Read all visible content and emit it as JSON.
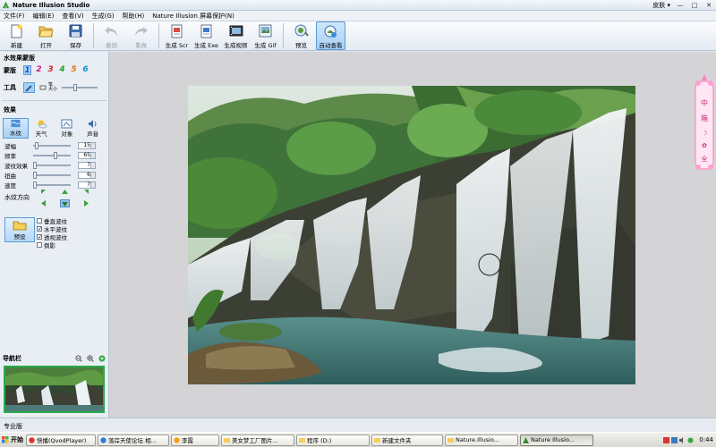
{
  "window": {
    "title": "Nature Illusion Studio",
    "skin_label": "皮肤 ▾",
    "minimize": "—",
    "maximize": "□",
    "close": "✕"
  },
  "menu": [
    "文件(F)",
    "编辑(E)",
    "查看(V)",
    "生成(G)",
    "帮助(H)",
    "Nature Illusion 屏幕保护(N)"
  ],
  "toolbar": {
    "buttons": [
      {
        "label": "新建",
        "icon": "new-file-icon"
      },
      {
        "label": "打开",
        "icon": "open-folder-icon"
      },
      {
        "label": "保存",
        "icon": "save-disk-icon"
      },
      {
        "label": "撤销",
        "icon": "undo-icon"
      },
      {
        "label": "重做",
        "icon": "redo-icon"
      },
      {
        "label": "生成 Scr",
        "icon": "generate-scr-icon"
      },
      {
        "label": "生成 Exe",
        "icon": "generate-exe-icon"
      },
      {
        "label": "生成视频",
        "icon": "generate-video-icon"
      },
      {
        "label": "生成 Gif",
        "icon": "generate-gif-icon"
      },
      {
        "label": "预览",
        "icon": "preview-icon"
      },
      {
        "label": "自动查看",
        "icon": "auto-view-icon"
      }
    ]
  },
  "left": {
    "water_title": "水效果蒙版",
    "mask_label": "蒙版",
    "numbers": [
      "1",
      "2",
      "3",
      "4",
      "5",
      "6"
    ],
    "number_colors": [
      "#1e4fd8",
      "#d01c8b",
      "#e02020",
      "#2a9a2a",
      "#e07a10",
      "#1a8fd6"
    ],
    "tools_label": "工具",
    "size_label": "笔\n大小",
    "effects_title": "效果",
    "tabs": [
      "水纹",
      "天气",
      "对象",
      "声音"
    ],
    "params": [
      {
        "name": "波幅",
        "value": "15",
        "level": 0.06
      },
      {
        "name": "频率",
        "value": "65",
        "level": 0.55
      },
      {
        "name": "波纹效果",
        "value": "7",
        "level": 0.02
      },
      {
        "name": "扭曲",
        "value": "6",
        "level": 0.02
      },
      {
        "name": "速度",
        "value": "7",
        "level": 0.02
      }
    ],
    "direction_label": "水纹方向",
    "preset_label": "预设",
    "checks": [
      {
        "label": "垂直波纹",
        "checked": false
      },
      {
        "label": "水平波纹",
        "checked": true
      },
      {
        "label": "透视波纹",
        "checked": true
      },
      {
        "label": "倒影",
        "checked": false
      }
    ],
    "nav_title": "导航栏"
  },
  "status": "专业版",
  "taskbar": {
    "start": "开始",
    "tasks": [
      {
        "label": "快播(QvodPlayer)",
        "active": false
      },
      {
        "label": "落岸天使论坛 相...",
        "active": false
      },
      {
        "label": "李霞",
        "active": false
      },
      {
        "label": "美女梦工厂图片...",
        "active": false
      },
      {
        "label": "程序 (D:)",
        "active": false
      },
      {
        "label": "新建文件夹",
        "active": false
      },
      {
        "label": "Nature.Illusio...",
        "active": false
      },
      {
        "label": "Nature Illusio...",
        "active": true
      }
    ],
    "clock": "0:44"
  },
  "deco_text": "中 ▾ 箱 ☽ ✿ 全"
}
